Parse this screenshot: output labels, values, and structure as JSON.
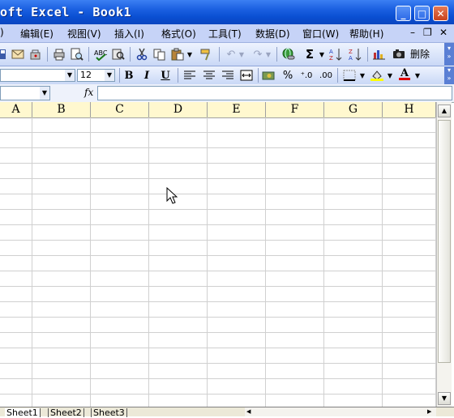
{
  "window": {
    "title": "oft Excel - Book1"
  },
  "caption_buttons": {
    "minimize": "_",
    "maximize": "□",
    "close": "✕"
  },
  "menu": {
    "items": [
      "编辑(E)",
      "视图(V)",
      "插入(I)",
      "格式(O)",
      "工具(T)",
      "数据(D)",
      "窗口(W)",
      "帮助(H)"
    ],
    "doc_controls": {
      "minimize": "–",
      "restore": "❐",
      "close": "✕"
    },
    "left_fragment": ")"
  },
  "toolbar_standard": {
    "icons": [
      "save-icon",
      "email-icon",
      "print-icon",
      "print-preview-icon",
      "spellcheck-icon",
      "research-icon",
      "cut-icon",
      "copy-icon",
      "paste-icon",
      "format-painter-icon",
      "undo-icon",
      "redo-icon",
      "hyperlink-icon",
      "autosum-icon",
      "sort-ascending-icon",
      "sort-descending-icon",
      "chart-wizard-icon",
      "camera-icon"
    ],
    "autosum_symbol": "Σ",
    "delete_label": "删除"
  },
  "toolbar_format": {
    "font_size": "12",
    "bold": "B",
    "italic": "I",
    "underline": "U",
    "percent": "%",
    "inc_decimal": "⁺.0",
    "dec_decimal": ".00",
    "font_color_letter": "A",
    "colors": {
      "fill": "#ffff00",
      "font": "#e00000"
    }
  },
  "formula_bar": {
    "fx": "fx",
    "name_box": "",
    "value": ""
  },
  "grid": {
    "columns": [
      "A",
      "B",
      "C",
      "D",
      "E",
      "F",
      "G",
      "H"
    ],
    "gridline_color": "#d0d0d0",
    "header_bg": "#fff8cf"
  },
  "sheets": {
    "tabs": [
      "Sheet1",
      "Sheet2",
      "Sheet3"
    ],
    "active": "Sheet1"
  },
  "scroll_arrows": {
    "up": "▲",
    "down": "▼",
    "left": "◀",
    "right": "▶"
  },
  "accent": "#0a4fd2"
}
